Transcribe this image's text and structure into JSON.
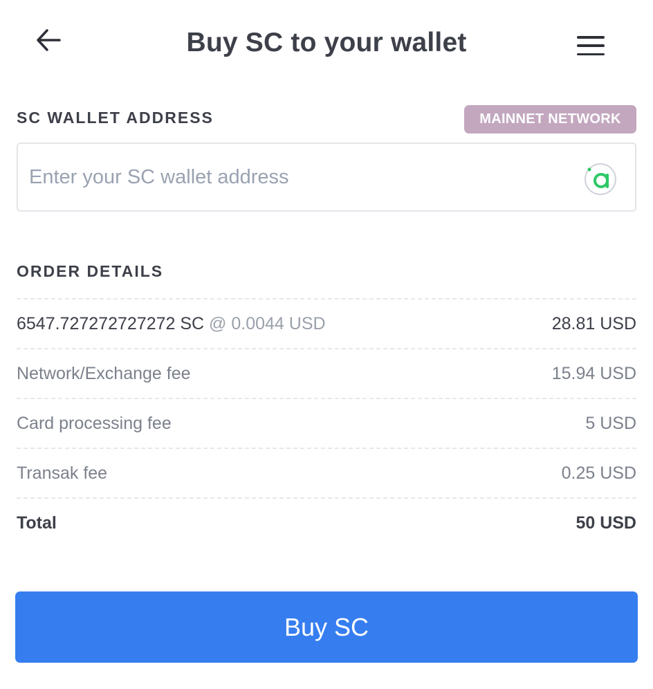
{
  "header": {
    "title": "Buy SC to your wallet",
    "back_icon": "arrow-left-icon",
    "menu_icon": "hamburger-menu-icon"
  },
  "wallet": {
    "label": "SC WALLET ADDRESS",
    "network_badge": "MAINNET NETWORK",
    "address_value": "",
    "address_placeholder": "Enter your SC wallet address",
    "coin_icon": "siacoin-logo-icon"
  },
  "order": {
    "label": "ORDER DETAILS",
    "purchase": {
      "amount": "6547.727272727272 SC",
      "rate": "@ 0.0044 USD",
      "value": "28.81 USD"
    },
    "fees": [
      {
        "label": "Network/Exchange fee",
        "value": "15.94 USD"
      },
      {
        "label": "Card processing fee",
        "value": "5 USD"
      },
      {
        "label": "Transak fee",
        "value": "0.25 USD"
      }
    ],
    "total": {
      "label": "Total",
      "value": "50 USD"
    }
  },
  "buy_button": {
    "label": "Buy SC"
  },
  "colors": {
    "primary_button": "#367ef0",
    "badge": "#c2a7bf",
    "coin_icon_green": "#2ec866"
  }
}
